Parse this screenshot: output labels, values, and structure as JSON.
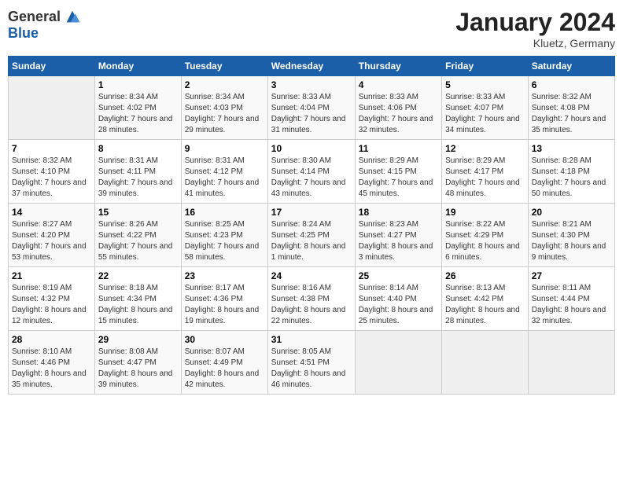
{
  "logo": {
    "general": "General",
    "blue": "Blue"
  },
  "title": "January 2024",
  "location": "Kluetz, Germany",
  "days_of_week": [
    "Sunday",
    "Monday",
    "Tuesday",
    "Wednesday",
    "Thursday",
    "Friday",
    "Saturday"
  ],
  "weeks": [
    [
      {
        "day": "",
        "sunrise": "",
        "sunset": "",
        "daylight": ""
      },
      {
        "day": "1",
        "sunrise": "Sunrise: 8:34 AM",
        "sunset": "Sunset: 4:02 PM",
        "daylight": "Daylight: 7 hours and 28 minutes."
      },
      {
        "day": "2",
        "sunrise": "Sunrise: 8:34 AM",
        "sunset": "Sunset: 4:03 PM",
        "daylight": "Daylight: 7 hours and 29 minutes."
      },
      {
        "day": "3",
        "sunrise": "Sunrise: 8:33 AM",
        "sunset": "Sunset: 4:04 PM",
        "daylight": "Daylight: 7 hours and 31 minutes."
      },
      {
        "day": "4",
        "sunrise": "Sunrise: 8:33 AM",
        "sunset": "Sunset: 4:06 PM",
        "daylight": "Daylight: 7 hours and 32 minutes."
      },
      {
        "day": "5",
        "sunrise": "Sunrise: 8:33 AM",
        "sunset": "Sunset: 4:07 PM",
        "daylight": "Daylight: 7 hours and 34 minutes."
      },
      {
        "day": "6",
        "sunrise": "Sunrise: 8:32 AM",
        "sunset": "Sunset: 4:08 PM",
        "daylight": "Daylight: 7 hours and 35 minutes."
      }
    ],
    [
      {
        "day": "7",
        "sunrise": "Sunrise: 8:32 AM",
        "sunset": "Sunset: 4:10 PM",
        "daylight": "Daylight: 7 hours and 37 minutes."
      },
      {
        "day": "8",
        "sunrise": "Sunrise: 8:31 AM",
        "sunset": "Sunset: 4:11 PM",
        "daylight": "Daylight: 7 hours and 39 minutes."
      },
      {
        "day": "9",
        "sunrise": "Sunrise: 8:31 AM",
        "sunset": "Sunset: 4:12 PM",
        "daylight": "Daylight: 7 hours and 41 minutes."
      },
      {
        "day": "10",
        "sunrise": "Sunrise: 8:30 AM",
        "sunset": "Sunset: 4:14 PM",
        "daylight": "Daylight: 7 hours and 43 minutes."
      },
      {
        "day": "11",
        "sunrise": "Sunrise: 8:29 AM",
        "sunset": "Sunset: 4:15 PM",
        "daylight": "Daylight: 7 hours and 45 minutes."
      },
      {
        "day": "12",
        "sunrise": "Sunrise: 8:29 AM",
        "sunset": "Sunset: 4:17 PM",
        "daylight": "Daylight: 7 hours and 48 minutes."
      },
      {
        "day": "13",
        "sunrise": "Sunrise: 8:28 AM",
        "sunset": "Sunset: 4:18 PM",
        "daylight": "Daylight: 7 hours and 50 minutes."
      }
    ],
    [
      {
        "day": "14",
        "sunrise": "Sunrise: 8:27 AM",
        "sunset": "Sunset: 4:20 PM",
        "daylight": "Daylight: 7 hours and 53 minutes."
      },
      {
        "day": "15",
        "sunrise": "Sunrise: 8:26 AM",
        "sunset": "Sunset: 4:22 PM",
        "daylight": "Daylight: 7 hours and 55 minutes."
      },
      {
        "day": "16",
        "sunrise": "Sunrise: 8:25 AM",
        "sunset": "Sunset: 4:23 PM",
        "daylight": "Daylight: 7 hours and 58 minutes."
      },
      {
        "day": "17",
        "sunrise": "Sunrise: 8:24 AM",
        "sunset": "Sunset: 4:25 PM",
        "daylight": "Daylight: 8 hours and 1 minute."
      },
      {
        "day": "18",
        "sunrise": "Sunrise: 8:23 AM",
        "sunset": "Sunset: 4:27 PM",
        "daylight": "Daylight: 8 hours and 3 minutes."
      },
      {
        "day": "19",
        "sunrise": "Sunrise: 8:22 AM",
        "sunset": "Sunset: 4:29 PM",
        "daylight": "Daylight: 8 hours and 6 minutes."
      },
      {
        "day": "20",
        "sunrise": "Sunrise: 8:21 AM",
        "sunset": "Sunset: 4:30 PM",
        "daylight": "Daylight: 8 hours and 9 minutes."
      }
    ],
    [
      {
        "day": "21",
        "sunrise": "Sunrise: 8:19 AM",
        "sunset": "Sunset: 4:32 PM",
        "daylight": "Daylight: 8 hours and 12 minutes."
      },
      {
        "day": "22",
        "sunrise": "Sunrise: 8:18 AM",
        "sunset": "Sunset: 4:34 PM",
        "daylight": "Daylight: 8 hours and 15 minutes."
      },
      {
        "day": "23",
        "sunrise": "Sunrise: 8:17 AM",
        "sunset": "Sunset: 4:36 PM",
        "daylight": "Daylight: 8 hours and 19 minutes."
      },
      {
        "day": "24",
        "sunrise": "Sunrise: 8:16 AM",
        "sunset": "Sunset: 4:38 PM",
        "daylight": "Daylight: 8 hours and 22 minutes."
      },
      {
        "day": "25",
        "sunrise": "Sunrise: 8:14 AM",
        "sunset": "Sunset: 4:40 PM",
        "daylight": "Daylight: 8 hours and 25 minutes."
      },
      {
        "day": "26",
        "sunrise": "Sunrise: 8:13 AM",
        "sunset": "Sunset: 4:42 PM",
        "daylight": "Daylight: 8 hours and 28 minutes."
      },
      {
        "day": "27",
        "sunrise": "Sunrise: 8:11 AM",
        "sunset": "Sunset: 4:44 PM",
        "daylight": "Daylight: 8 hours and 32 minutes."
      }
    ],
    [
      {
        "day": "28",
        "sunrise": "Sunrise: 8:10 AM",
        "sunset": "Sunset: 4:46 PM",
        "daylight": "Daylight: 8 hours and 35 minutes."
      },
      {
        "day": "29",
        "sunrise": "Sunrise: 8:08 AM",
        "sunset": "Sunset: 4:47 PM",
        "daylight": "Daylight: 8 hours and 39 minutes."
      },
      {
        "day": "30",
        "sunrise": "Sunrise: 8:07 AM",
        "sunset": "Sunset: 4:49 PM",
        "daylight": "Daylight: 8 hours and 42 minutes."
      },
      {
        "day": "31",
        "sunrise": "Sunrise: 8:05 AM",
        "sunset": "Sunset: 4:51 PM",
        "daylight": "Daylight: 8 hours and 46 minutes."
      },
      {
        "day": "",
        "sunrise": "",
        "sunset": "",
        "daylight": ""
      },
      {
        "day": "",
        "sunrise": "",
        "sunset": "",
        "daylight": ""
      },
      {
        "day": "",
        "sunrise": "",
        "sunset": "",
        "daylight": ""
      }
    ]
  ]
}
